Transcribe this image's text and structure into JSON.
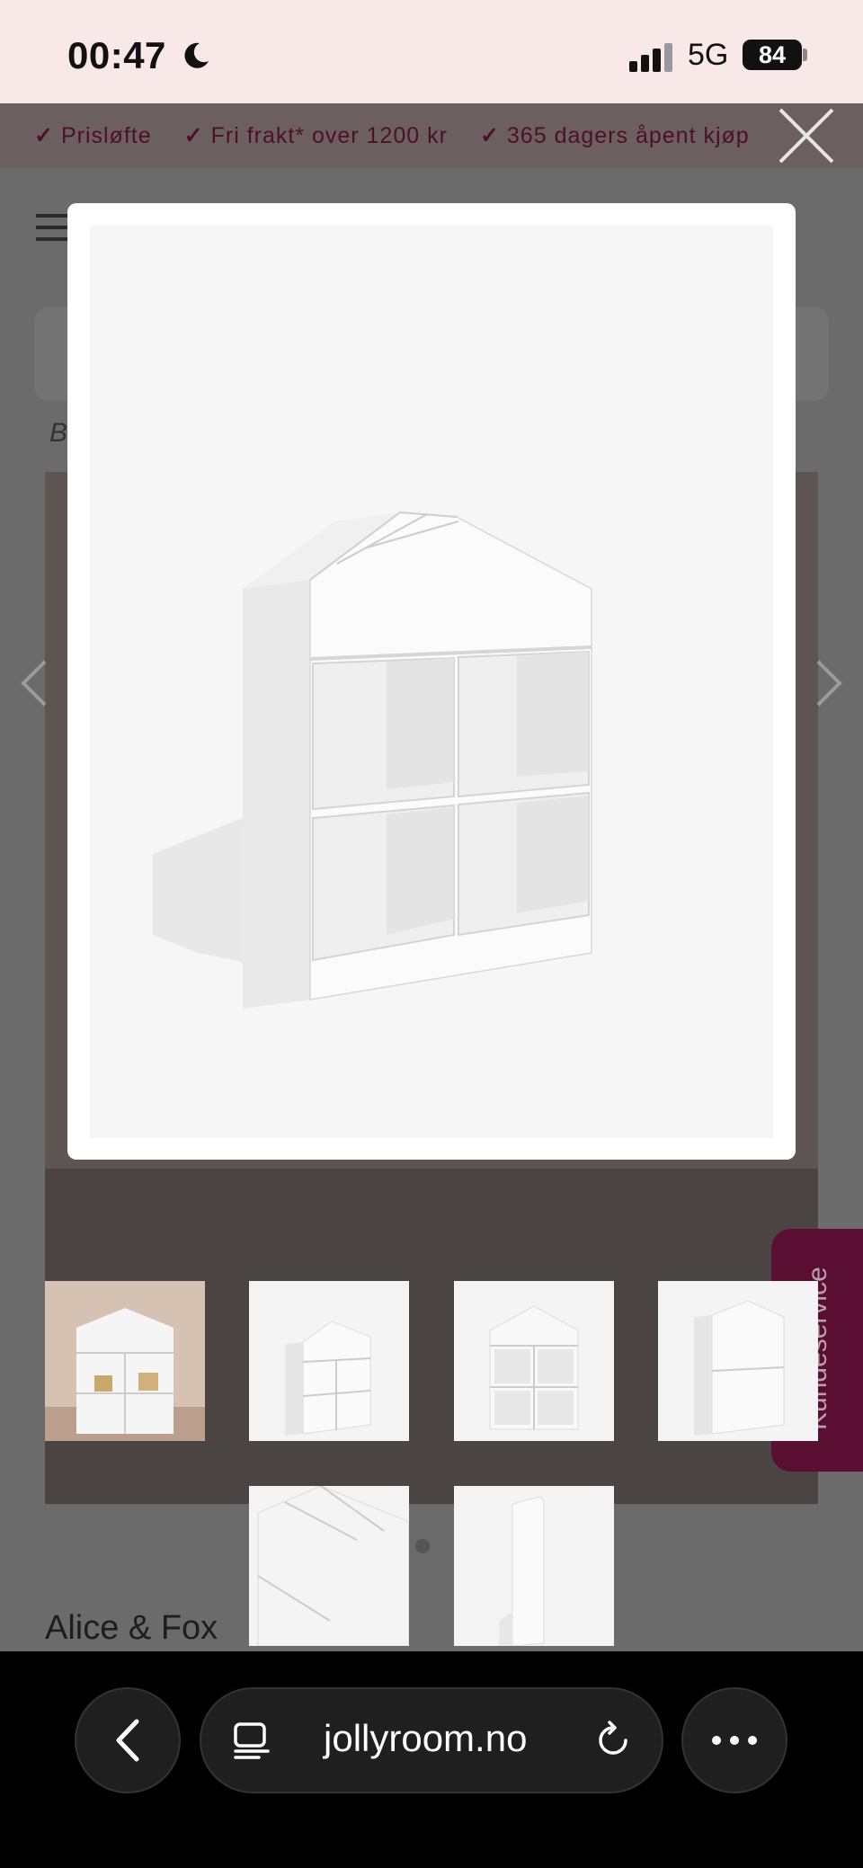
{
  "status": {
    "time": "00:47",
    "network": "5G",
    "battery": "84"
  },
  "usp": [
    {
      "label": "Prisløfte"
    },
    {
      "label": "Fri frakt* over 1200 kr"
    },
    {
      "label": "365 dagers åpent kjøp"
    }
  ],
  "breadcrumb": {
    "text": "B"
  },
  "product": {
    "brand": "Alice & Fox"
  },
  "customer_service": {
    "label": "Kundeservice"
  },
  "browser": {
    "url": "jollyroom.no"
  },
  "icons": {
    "close": "close-icon",
    "menu": "hamburger-menu-icon",
    "prev": "chevron-left-icon",
    "next": "chevron-right-icon",
    "back": "back-arrow-icon",
    "tabs": "tab-overview-icon",
    "reload": "reload-icon",
    "more": "more-icon"
  },
  "colors": {
    "accent": "#5a0f32",
    "usp_text": "#4e0f2b"
  }
}
